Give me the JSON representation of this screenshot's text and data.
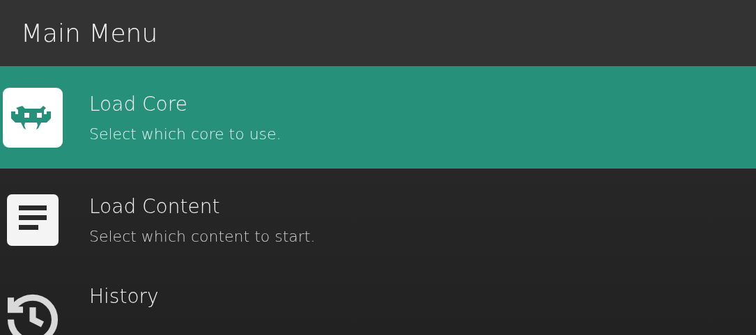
{
  "header": {
    "title": "Main Menu"
  },
  "items": [
    {
      "kind": "core",
      "label": "Load Core",
      "description": "Select which core to use.",
      "selected": true
    },
    {
      "kind": "content",
      "label": "Load Content",
      "description": "Select which content to start.",
      "selected": false
    },
    {
      "kind": "history",
      "label": "History",
      "selected": false
    }
  ]
}
